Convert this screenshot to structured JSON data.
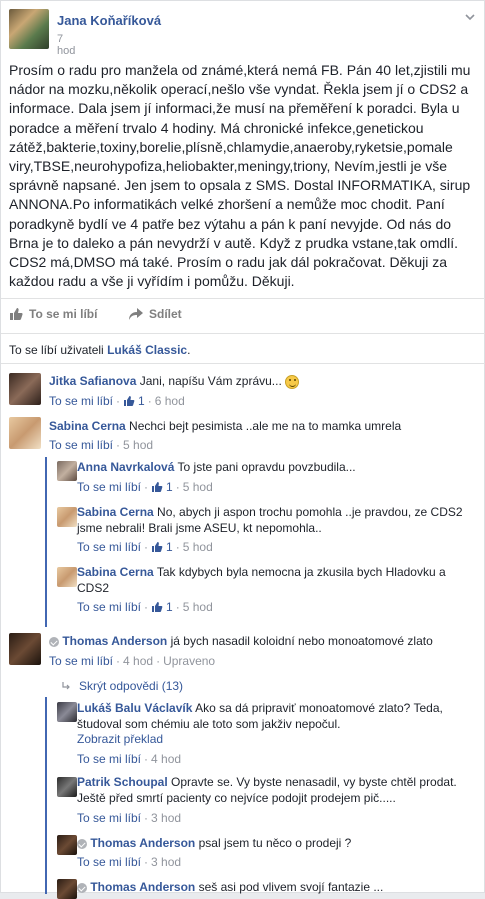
{
  "post": {
    "author": "Jana Koňaříková",
    "time": "7 hod",
    "text": "Prosím o radu pro manžela od známé,která nemá FB. Pán 40 let,zjistili mu nádor na mozku,několik operací,nešlo vše vyndat. Řekla jsem jí o CDS2 a informace. Dala jsem jí informaci,že musí na přeměření k poradci. Byla u poradce a měření trvalo 4 hodiny. Má chronické infekce,genetickou zátěž,bakterie,toxiny,borelie,plísně,chlamydie,anaeroby,ryketsie,pomale viry,TBSE,neurohypofiza,heliobakter,meningy,triony, Nevím,jestli je vše správně napsané. Jen jsem to opsala z SMS. Dostal INFORMATIKA, sirup ANNONA.Po informatikách velké zhoršení a nemůže moc chodit. Paní poradkyně bydlí ve 4 patře bez výtahu a pán k paní nevyjde. Od nás do Brna je to daleko a pán nevydrží v autě. Když z prudka vstane,tak omdlí. CDS2 má,DMSO má také. Prosím o radu jak dál pokračovat. Děkuji za každou radu a vše ji vyřídím i pomůžu. Děkuji.",
    "like_label": "To se mi líbí",
    "share_label": "Sdílet",
    "likes_prefix": "To se líbí uživateli",
    "likes_user": "Lukáš Classic",
    "likes_suffix": "."
  },
  "comments": [
    {
      "name": "Jitka Safianova",
      "text": "Jani, napíšu Vám zprávu...",
      "like": "To se mi líbí",
      "likes": "1",
      "time": "6 hod"
    },
    {
      "name": "Sabina Cerna",
      "text": "Nechci bejt pesimista ..ale me na to mamka umrela",
      "like": "To se mi líbí",
      "time": "5 hod"
    },
    {
      "name": "Anna Navrkalová",
      "text": "To jste pani opravdu povzbudila...",
      "like": "To se mi líbí",
      "likes": "1",
      "time": "5 hod"
    },
    {
      "name": "Sabina Cerna",
      "text": "No, abych ji aspon trochu pomohla ..je pravdou, ze CDS2 jsme nebrali! Brali jsme ASEU, kt nepomohla..",
      "like": "To se mi líbí",
      "likes": "1",
      "time": "5 hod"
    },
    {
      "name": "Sabina Cerna",
      "text": "Tak kdybych byla nemocna ja zkusila bych Hladovku a CDS2",
      "like": "To se mi líbí",
      "likes": "1",
      "time": "5 hod"
    },
    {
      "name": "Thomas Anderson",
      "text": "já bych nasadil koloidní nebo monoatomové zlato",
      "like": "To se mi líbí",
      "time": "4 hod",
      "edited": "Upraveno"
    },
    {
      "name": "Lukáš Balu Václavík",
      "text": "Ako sa dá pripraviť monoatomové zlato? Teda, študoval som chémiu ale toto som jakživ nepočul.",
      "translate": "Zobrazit překlad",
      "like": "To se mi líbí",
      "time": "4 hod"
    },
    {
      "name": "Patrik Schoupal",
      "text": "Opravte se. Vy byste nenasadil, vy byste chtěl prodat. Ještě před smrtí pacienty co nejvíce podojit prodejem pič.....",
      "like": "To se mi líbí",
      "time": "3 hod"
    },
    {
      "name": "Thomas Anderson",
      "text": "psal jsem tu něco o prodeji ?",
      "like": "To se mi líbí",
      "time": "3 hod"
    },
    {
      "name": "Thomas Anderson",
      "text": "seš asi pod vlivem svojí fantazie ..."
    }
  ],
  "hide_replies": "Skrýt odpovědi (13)",
  "separator": "·",
  "colors": {
    "link": "#365899",
    "meta": "#90949c",
    "reply_bar": "#4267b2"
  }
}
